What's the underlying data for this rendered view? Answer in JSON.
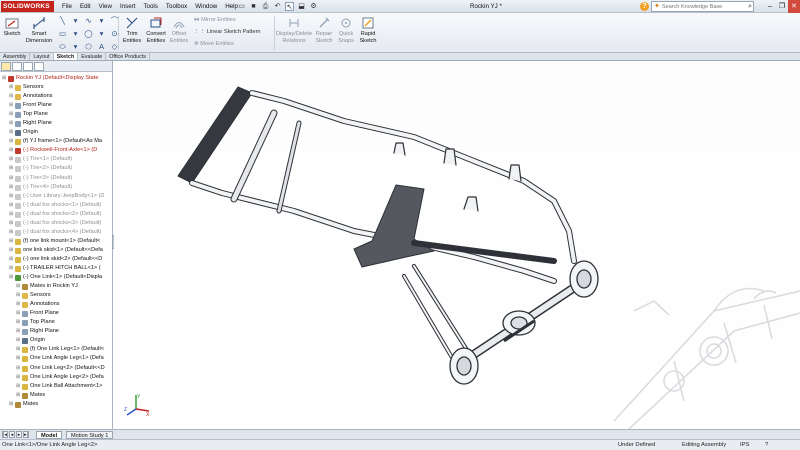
{
  "app": {
    "logo_text": "SOLIDWORKS",
    "doc_title": "Rockin YJ *"
  },
  "menu": [
    "File",
    "Edit",
    "View",
    "Insert",
    "Tools",
    "Toolbox",
    "Window",
    "Help"
  ],
  "search": {
    "placeholder": "Search Knowledge Base"
  },
  "commands": {
    "sketch": "Sketch",
    "smart_dimension": [
      "Smart",
      "Dimension"
    ],
    "trim": [
      "Trim",
      "Entities"
    ],
    "convert": [
      "Convert",
      "Entities"
    ],
    "offset": [
      "Offset",
      "Entities"
    ],
    "mirror": "Mirror Entities",
    "linear_pattern": "Linear Sketch Pattern",
    "move": "Move Entities",
    "relations": [
      "Display/Delete",
      "Relations"
    ],
    "repair": [
      "Repair",
      "Sketch"
    ],
    "quick_snaps": [
      "Quick",
      "Snaps"
    ],
    "rapid_sketch": [
      "Rapid",
      "Sketch"
    ]
  },
  "command_tabs": [
    "Assembly",
    "Layout",
    "Sketch",
    "Evaluate",
    "Office Products"
  ],
  "active_command_tab": "Sketch",
  "tree": [
    {
      "label": "Rockin YJ  (Default<Display State",
      "indent": 0,
      "color": "#c0392b",
      "style": "red"
    },
    {
      "label": "Sensors",
      "indent": 1,
      "color": "#e0b84a",
      "style": ""
    },
    {
      "label": "Annotations",
      "indent": 1,
      "color": "#e0b84a",
      "style": ""
    },
    {
      "label": "Front Plane",
      "indent": 1,
      "color": "#8aa0b8",
      "style": ""
    },
    {
      "label": "Top Plane",
      "indent": 1,
      "color": "#8aa0b8",
      "style": ""
    },
    {
      "label": "Right Plane",
      "indent": 1,
      "color": "#8aa0b8",
      "style": ""
    },
    {
      "label": "Origin",
      "indent": 1,
      "color": "#5a6f88",
      "style": ""
    },
    {
      "label": "(f) YJ frame<1> (Default<As Ma",
      "indent": 1,
      "color": "#d8b640",
      "style": ""
    },
    {
      "label": "(-) Rockwell-Front-Axle<1> (D",
      "indent": 1,
      "color": "#c0392b",
      "style": "red"
    },
    {
      "label": "(-) Tire<1> (Default)",
      "indent": 1,
      "color": "#c9c9c9",
      "style": "dim"
    },
    {
      "label": "(-) Tire<2> (Default)",
      "indent": 1,
      "color": "#c9c9c9",
      "style": "dim"
    },
    {
      "label": "(-) Tire<3> (Default)",
      "indent": 1,
      "color": "#c9c9c9",
      "style": "dim"
    },
    {
      "label": "(-) Tire<4> (Default)",
      "indent": 1,
      "color": "#c9c9c9",
      "style": "dim"
    },
    {
      "label": "(-) User Library-JeepBody<1> (D",
      "indent": 1,
      "color": "#c9c9c9",
      "style": "dim"
    },
    {
      "label": "(-) dual fox shocks<1> (Default)",
      "indent": 1,
      "color": "#c9c9c9",
      "style": "dim"
    },
    {
      "label": "(-) dual fox shocks<2> (Default)",
      "indent": 1,
      "color": "#c9c9c9",
      "style": "dim"
    },
    {
      "label": "(-) dual fox shocks<3> (Default)",
      "indent": 1,
      "color": "#c9c9c9",
      "style": "dim"
    },
    {
      "label": "(-) dual fox shocks<4> (Default)",
      "indent": 1,
      "color": "#c9c9c9",
      "style": "dim"
    },
    {
      "label": "(f) one link mount<1> (Default<",
      "indent": 1,
      "color": "#d8b640",
      "style": ""
    },
    {
      "label": "one link skid<1> (Default<<Defa",
      "indent": 1,
      "color": "#d8b640",
      "style": ""
    },
    {
      "label": "(-) one link skid<2> (Default<<D",
      "indent": 1,
      "color": "#d8b640",
      "style": ""
    },
    {
      "label": "(-) TRAILER HITCH BALL<1> (",
      "indent": 1,
      "color": "#d8b640",
      "style": ""
    },
    {
      "label": "(-) One Link<1> (Default<Displa",
      "indent": 1,
      "color": "#4c9a3a",
      "style": ""
    },
    {
      "label": "Mates in Rockin YJ",
      "indent": 2,
      "color": "#b08a3a",
      "style": ""
    },
    {
      "label": "Sensors",
      "indent": 2,
      "color": "#e0b84a",
      "style": ""
    },
    {
      "label": "Annotations",
      "indent": 2,
      "color": "#e0b84a",
      "style": ""
    },
    {
      "label": "Front Plane",
      "indent": 2,
      "color": "#8aa0b8",
      "style": ""
    },
    {
      "label": "Top Plane",
      "indent": 2,
      "color": "#8aa0b8",
      "style": ""
    },
    {
      "label": "Right Plane",
      "indent": 2,
      "color": "#8aa0b8",
      "style": ""
    },
    {
      "label": "Origin",
      "indent": 2,
      "color": "#5a6f88",
      "style": ""
    },
    {
      "label": "(f) One Link Leg<1> (Default<",
      "indent": 2,
      "color": "#d8b640",
      "style": ""
    },
    {
      "label": "One Link Angle Leg<1> (Defa",
      "indent": 2,
      "color": "#d8b640",
      "style": ""
    },
    {
      "label": "One Link Leg<2> (Default<<D",
      "indent": 2,
      "color": "#d8b640",
      "style": ""
    },
    {
      "label": "One Link Angle Leg<2> (Defa",
      "indent": 2,
      "color": "#d8b640",
      "style": ""
    },
    {
      "label": "One Link Ball Attachment<1>",
      "indent": 2,
      "color": "#d8b640",
      "style": ""
    },
    {
      "label": "Mates",
      "indent": 2,
      "color": "#b08a3a",
      "style": ""
    },
    {
      "label": "Mates",
      "indent": 1,
      "color": "#b08a3a",
      "style": ""
    }
  ],
  "bottom_tabs": [
    "Model",
    "Motion Study 1"
  ],
  "active_bottom_tab": "Model",
  "status": {
    "left": "One Link<1>/One Link Angle Leg<2>",
    "state": "Under Defined",
    "mode": "Editing Assembly",
    "units": "IPS"
  },
  "colors": {
    "logo": "#c4231b",
    "accent": "#2a4f85",
    "close": "#d24a3c"
  }
}
